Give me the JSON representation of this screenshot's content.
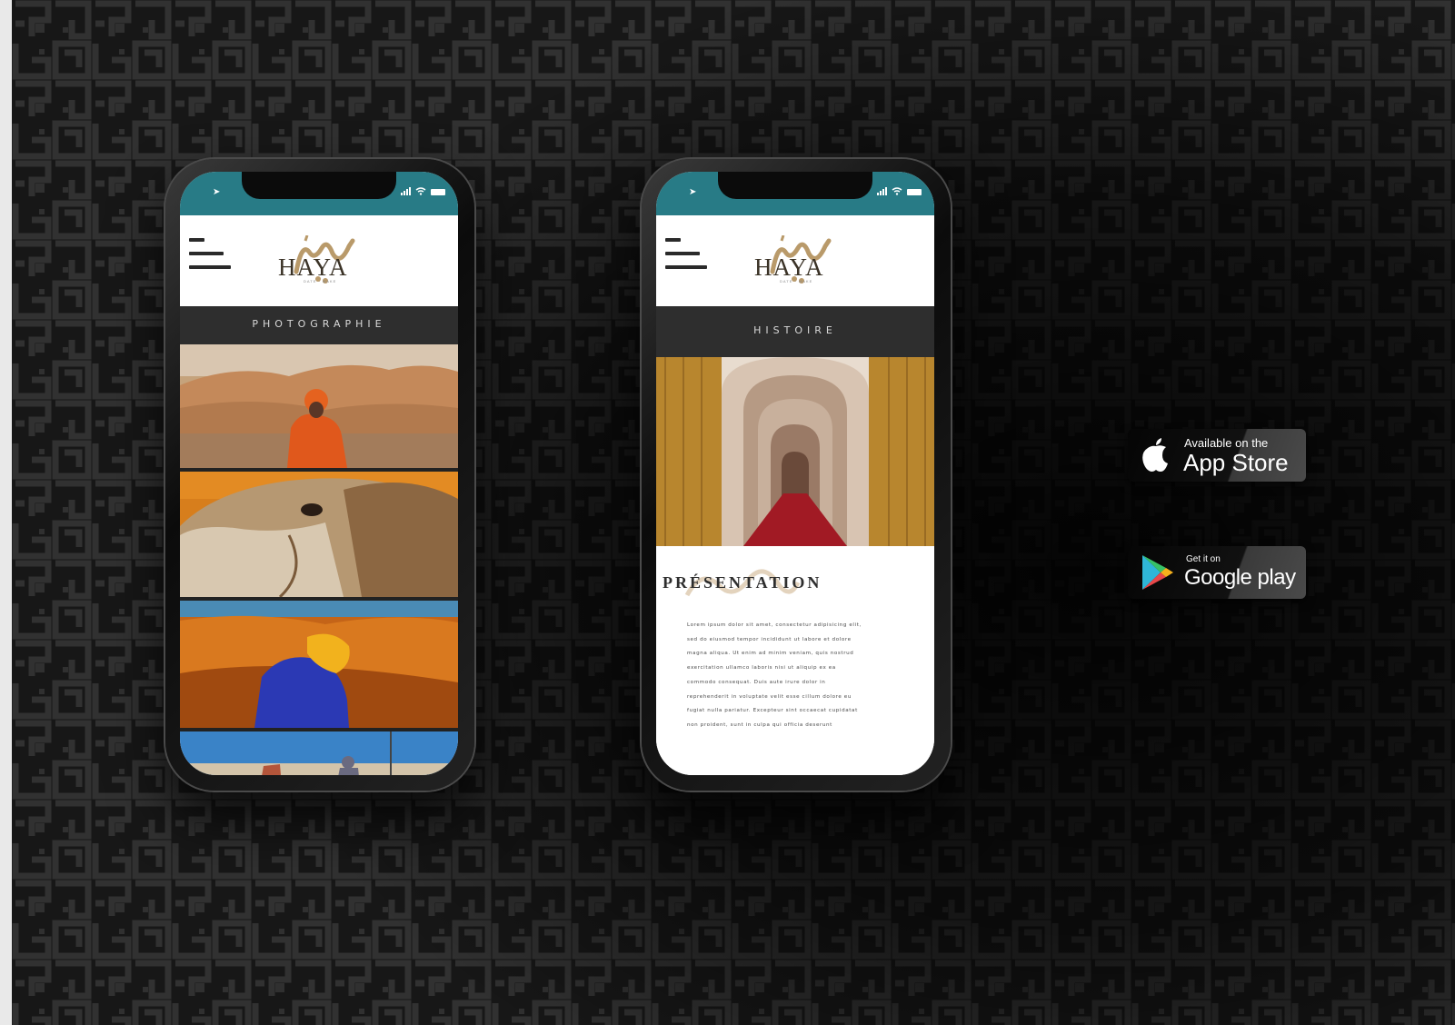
{
  "app": {
    "logo_text": "HAYA",
    "logo_sub": "DATE · MAKE",
    "brand_color": "#287b86"
  },
  "phone_left": {
    "section_title": "PHOTOGRAPHIE",
    "icons": [
      "location-arrow-icon",
      "signal-icon",
      "wifi-icon",
      "battery-icon",
      "hamburger-menu-icon"
    ]
  },
  "phone_right": {
    "section_title": "HISTOIRE",
    "heading": "PRÉSENTATION",
    "body_lines": [
      "Lorem ipsum dolor sit amet, consectetur adipisicing elit,",
      "sed do eiusmod tempor incididunt ut labore et dolore",
      "magna aliqua. Ut enim ad minim veniam, quis nostrud",
      "exercitation ullamco laboris nisi ut aliquip ex ea",
      "commodo consequat. Duis aute irure dolor in",
      "reprehenderit in voluptate velit esse cillum dolore eu",
      "fugiat nulla pariatur. Excepteur sint occaecat cupidatat",
      "non proident, sunt in culpa qui officia deserunt"
    ]
  },
  "store": {
    "appstore_small": "Available on the",
    "appstore_big": "App Store",
    "googleplay_small": "Get it on",
    "googleplay_big": "Google play"
  }
}
